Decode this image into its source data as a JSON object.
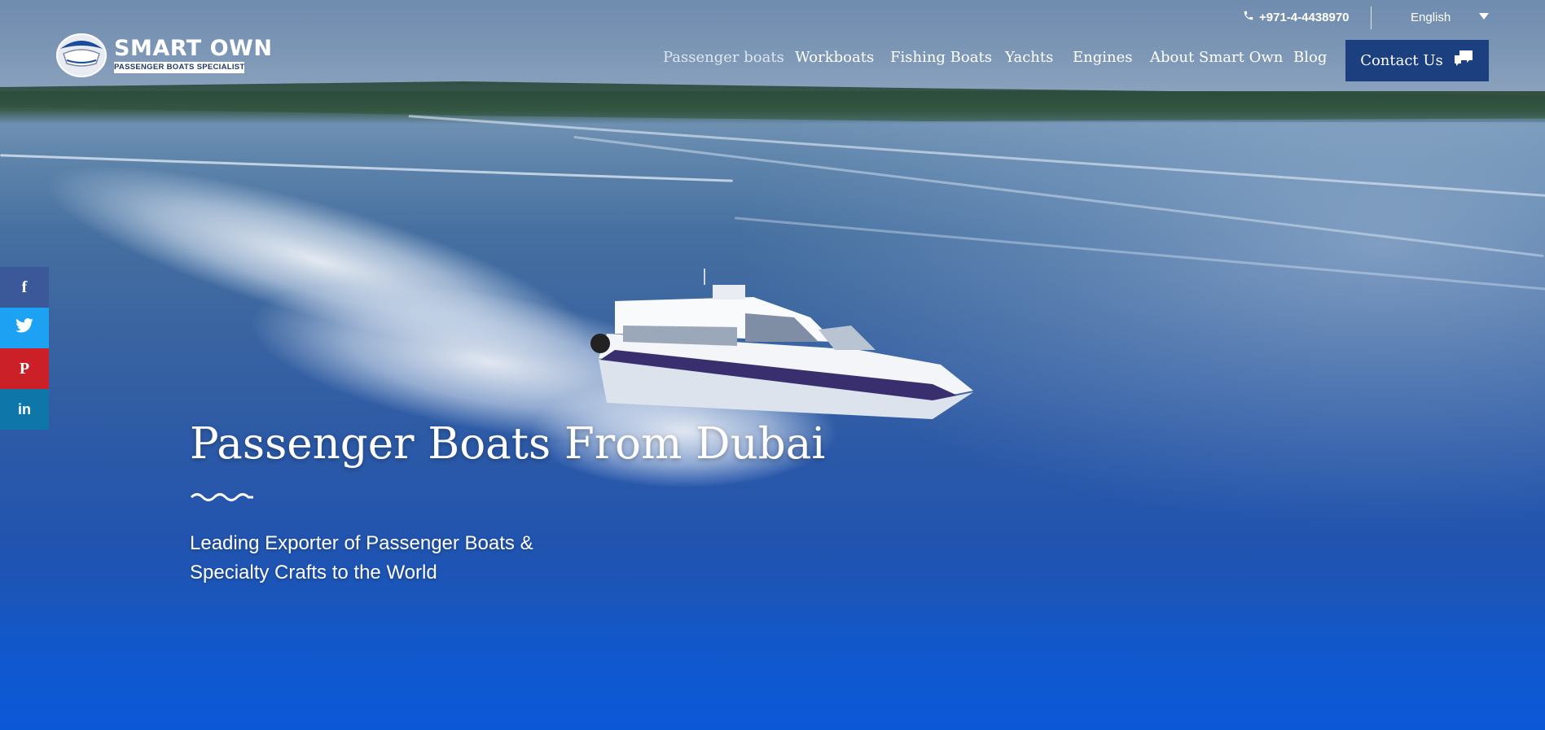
{
  "header": {
    "phone": "+971-4-4438970",
    "language": "English",
    "logo_title": "SMART OWN",
    "logo_subtitle": "PASSENGER BOATS SPECIALIST",
    "contact_label": "Contact Us"
  },
  "nav": {
    "items": [
      {
        "label": "Passenger boats",
        "active": true
      },
      {
        "label": "Workboats"
      },
      {
        "label": "Fishing Boats"
      },
      {
        "label": "Yachts"
      },
      {
        "label": "Engines"
      },
      {
        "label": "About Smart Own"
      },
      {
        "label": "Blog"
      }
    ]
  },
  "social": [
    {
      "name": "facebook",
      "glyph": "f",
      "color": "#3b5998"
    },
    {
      "name": "twitter",
      "glyph": "t",
      "color": "#1da1f2"
    },
    {
      "name": "pinterest",
      "glyph": "p",
      "color": "#cb2027"
    },
    {
      "name": "linkedin",
      "glyph": "in",
      "color": "#0e76a8"
    }
  ],
  "hero": {
    "title": "Passenger Boats From Dubai",
    "subtitle": "Leading Exporter of Passenger Boats & Specialty Crafts to the World"
  }
}
